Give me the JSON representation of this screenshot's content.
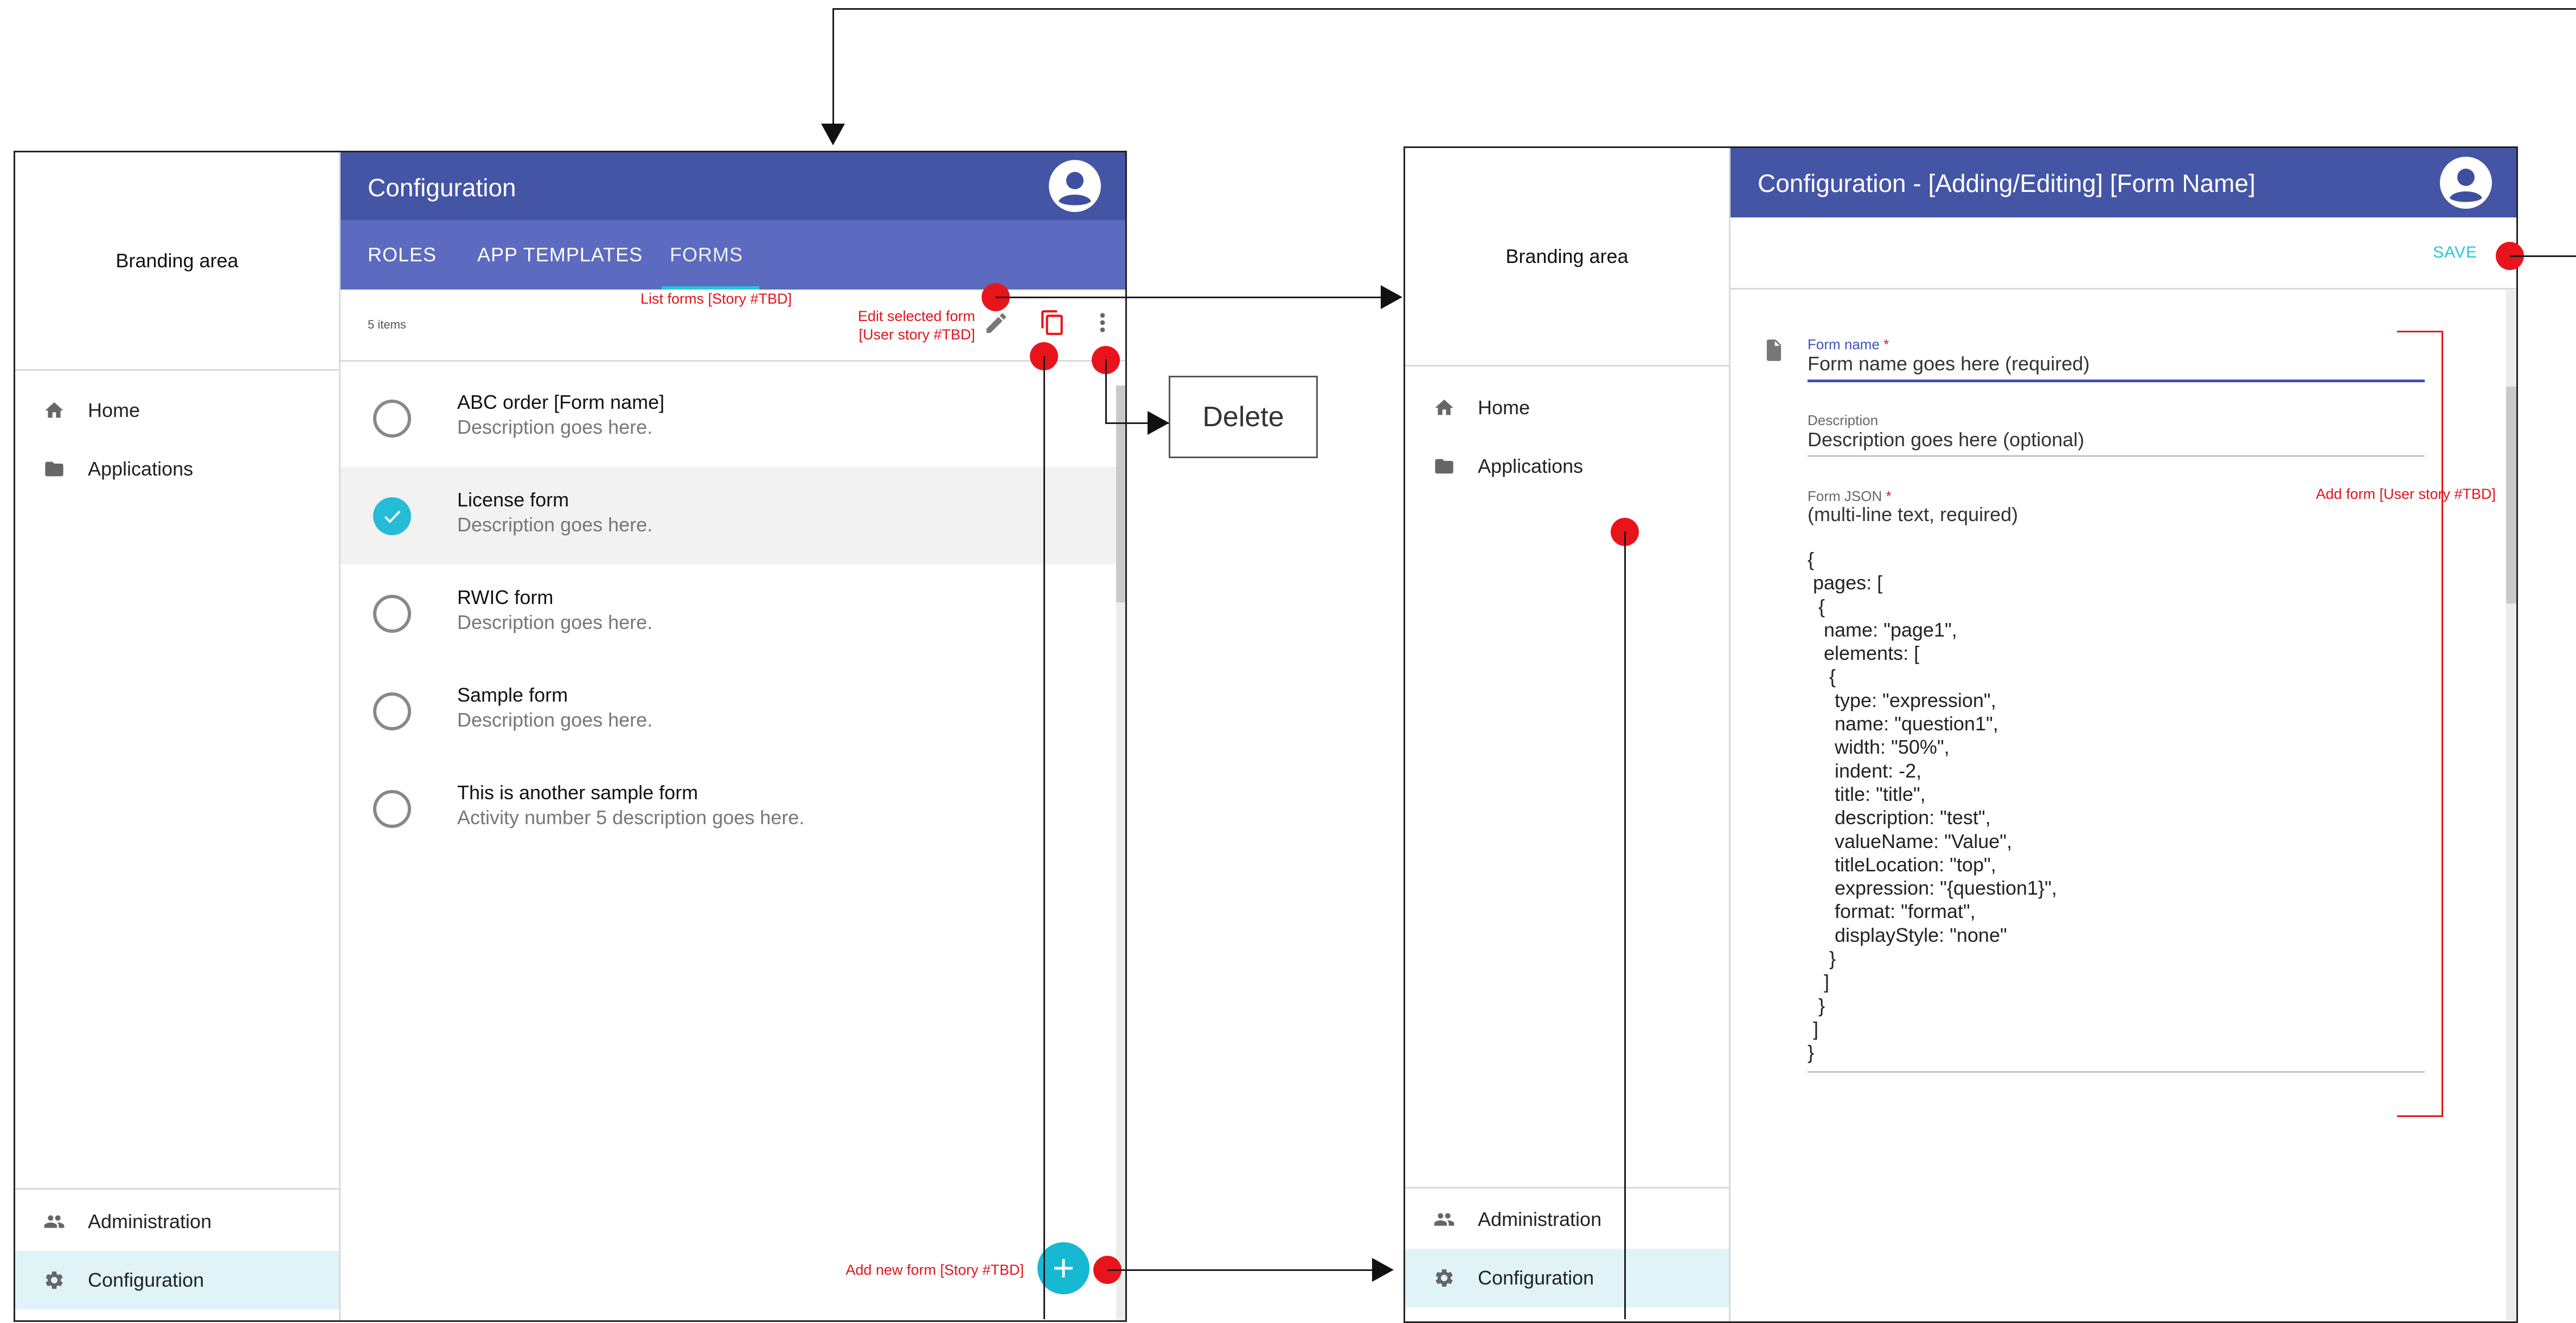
{
  "left_screen": {
    "brand": "Branding area",
    "nav": [
      {
        "label": "Home",
        "icon": "home-icon"
      },
      {
        "label": "Applications",
        "icon": "folder-icon"
      }
    ],
    "bottom_nav": [
      {
        "label": "Administration",
        "icon": "people-icon"
      },
      {
        "label": "Configuration",
        "icon": "gear-icon"
      }
    ],
    "title": "Configuration",
    "tabs": [
      "ROLES",
      "APP TEMPLATES",
      "FORMS"
    ],
    "active_tab": "FORMS",
    "item_count": "5 items",
    "items": [
      {
        "title": "ABC order [Form name]",
        "desc": "Description goes here.",
        "selected": false
      },
      {
        "title": "License form",
        "desc": "Description goes here.",
        "selected": true
      },
      {
        "title": "RWIC form",
        "desc": "Description goes here.",
        "selected": false
      },
      {
        "title": "Sample form",
        "desc": "Description goes here.",
        "selected": false
      },
      {
        "title": "This is another sample form",
        "desc": "Activity number 5 description goes here.",
        "selected": false
      }
    ]
  },
  "annotations": {
    "list_forms": "List forms [Story #TBD]",
    "edit_selected_1": "Edit selected form",
    "edit_selected_2": "[User story #TBD]",
    "add_new": "Add new form [Story #TBD]",
    "add_form": "Add form [User story #TBD]",
    "delete": "Delete"
  },
  "right_screen": {
    "brand": "Branding area",
    "nav": [
      {
        "label": "Home",
        "icon": "home-icon"
      },
      {
        "label": "Applications",
        "icon": "folder-icon"
      }
    ],
    "bottom_nav": [
      {
        "label": "Administration",
        "icon": "people-icon"
      },
      {
        "label": "Configuration",
        "icon": "gear-icon"
      }
    ],
    "title": "Configuration - [Adding/Editing] [Form Name]",
    "save": "SAVE",
    "form_name_label": "Form name",
    "form_name_value": "Form name goes here (required)",
    "description_label": "Description",
    "description_value": "Description goes here (optional)",
    "json_label": "Form JSON",
    "required_mark": "*",
    "json_hint": "(multi-line text, required)",
    "json_lines": [
      "{",
      " pages: [",
      "  {",
      "   name: \"page1\",",
      "   elements: [",
      "    {",
      "     type: \"expression\",",
      "     name: \"question1\",",
      "     width: \"50%\",",
      "     indent: -2,",
      "     title: \"title\",",
      "     description: \"test\",",
      "     valueName: \"Value\",",
      "     titleLocation: \"top\",",
      "     expression: \"{question1}\",",
      "     format: \"format\",",
      "     displayStyle: \"none\"",
      "    }",
      "   ]",
      "  }",
      " ]",
      "}"
    ]
  },
  "colors": {
    "appbar": "#4455a6",
    "tabbar": "#5c6bc0",
    "accent": "#26c6da",
    "annotation": "#e0141c",
    "selected_row": "#f2f2f2",
    "active_nav": "#e0f4f8"
  }
}
